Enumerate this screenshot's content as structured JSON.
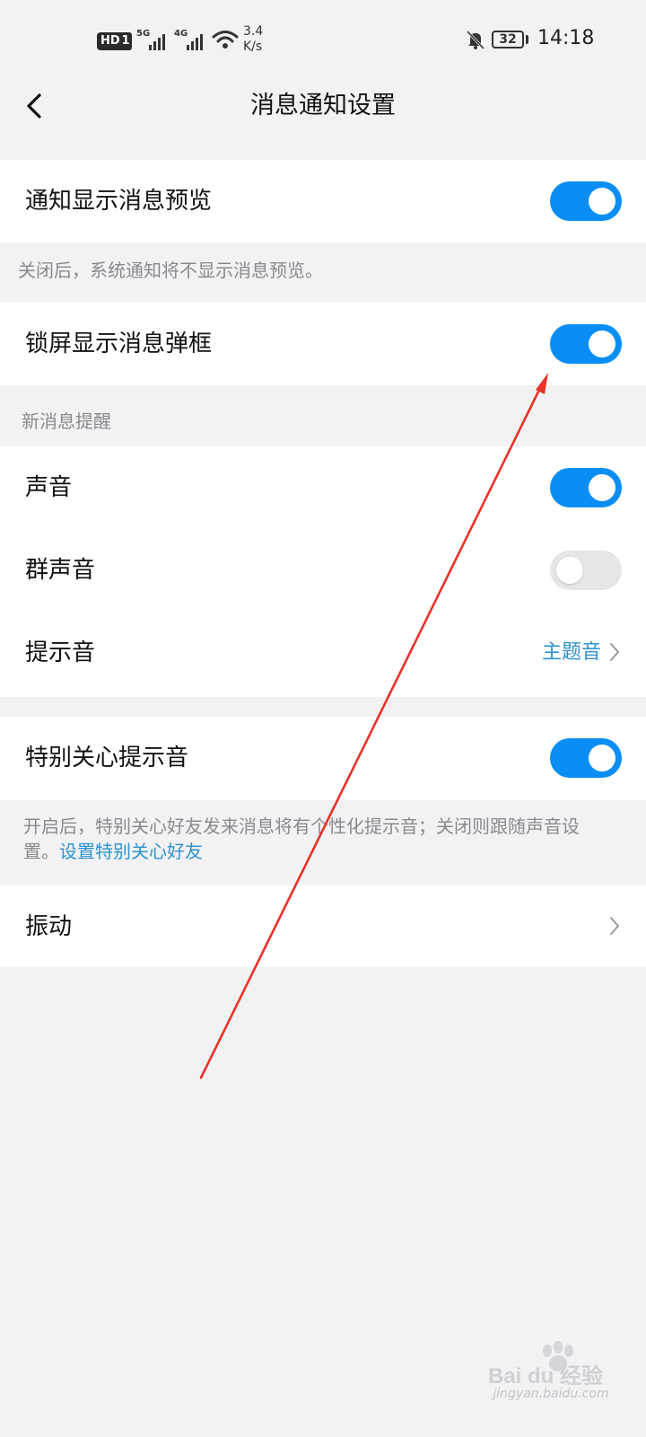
{
  "status_bar": {
    "hd": "HD",
    "sim": "1",
    "net1": "5G",
    "net2": "4G",
    "speed_value": "3.4",
    "speed_unit": "K/s",
    "battery": "32",
    "time": "14:18"
  },
  "header": {
    "title": "消息通知设置"
  },
  "settings": {
    "preview": {
      "label": "通知显示消息预览",
      "enabled": true
    },
    "preview_note": "关闭后，系统通知将不显示消息预览。",
    "lockscreen": {
      "label": "锁屏显示消息弹框",
      "enabled": true
    },
    "new_msg_section": "新消息提醒",
    "sound": {
      "label": "声音",
      "enabled": true
    },
    "group_sound": {
      "label": "群声音",
      "enabled": false
    },
    "tone": {
      "label": "提示音",
      "value": "主题音"
    },
    "special_tone": {
      "label": "特别关心提示音",
      "enabled": true
    },
    "special_note": "开启后，特别关心好友发来消息将有个性化提示音；关闭则跟随声音设置。",
    "special_link": "设置特别关心好友",
    "vibrate": {
      "label": "振动"
    }
  },
  "watermark": {
    "brand": "Bai du 经验",
    "url": "jingyan.baidu.com"
  },
  "colors": {
    "accent": "#0a8ef6",
    "link": "#2f92d0",
    "annotation_arrow": "#e8322b"
  }
}
